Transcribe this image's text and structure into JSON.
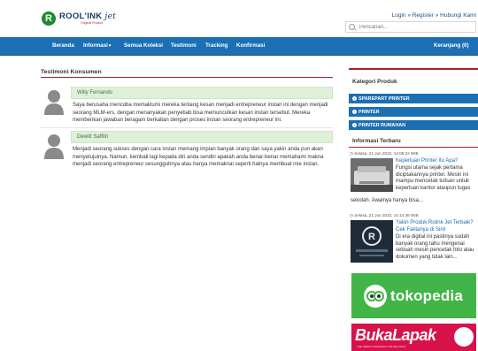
{
  "brand": {
    "logo_letter": "R",
    "name": "ROOL'INK",
    "name_suffix": "jet",
    "tagline": "Original Product"
  },
  "header": {
    "links": [
      "Login",
      "Register",
      "Hubungi Kami"
    ],
    "links_text": "Login » Register » Hubungi Kami",
    "search_placeholder": "Pencarian..."
  },
  "nav": {
    "items": [
      "Beranda",
      "Informasi",
      "Semua Koleksi",
      "Testimoni",
      "Tracking",
      "Konfirmasi"
    ],
    "informasi_caret": "▾",
    "cart": "Keranjang (0)"
  },
  "main": {
    "title": "Testimoni Konsumen",
    "testimonials": [
      {
        "name": "Willy Fernando",
        "text": "Saya berusaha mencoba memaklumi mereka tentang kesan menjadi entrepreneur instan ini dengan menjadi seorang MLM-ers, dengan menanyakan penyebab bisa memunculkan kesan instan tersebut. Mereka memberikan jawaban beragam berkaitan dengan proses instan seorang entrepreneur ini."
      },
      {
        "name": "Dewitt Saffitri",
        "text": "Menjadi seorang sukses dengan cara instan memang impian banyak orang dan saya yakin anda pun akan menyetujuinya. Namun, kembali lagi kepada diri anda sendiri apakah anda benar-benar memahami makna menjadi seorang entrepreneur sesungguhnya atau hanya memaknai seperti halnya membuat mie instan."
      }
    ]
  },
  "sidebar": {
    "kategori_title": "Kategori Produk",
    "categories": [
      "SPAREPART PRINTER",
      "PRINTER",
      "PRINTER RUMAHAN"
    ],
    "info_title": "Informasi Terbaru",
    "posts": [
      {
        "date": "Selasa, 21 Jun 2022, 14:09:22 WIB",
        "title": "Keperluan Printer Itu Apa?",
        "text_side": "Fungsi utama sejak pertama diciptakannya printer. Mesin ini mampu mencetak tulisan untuk keperluan kantor ataupun tugas",
        "text_below": "sekolah. Awalnya hanya bisa..."
      },
      {
        "date": "Selasa, 21 Jun 2022, 14:14:36 WIB",
        "title": "Yakin Produk Rolink Jet Terbaik? Cek Faktanya di Sini!",
        "text_side": "Di era digital ini pastinya sudah banyak orang tahu mengenai sebuah mesin pencetak foto atau dokumen yang tidak lain..."
      }
    ],
    "tokopedia": "tokopedia",
    "bukalapak": "BukaLapak",
    "bukalapak_sub": "THE GREAT INDONESIA ONLINE SHOP"
  },
  "colors": {
    "nav": "#1c6fb3",
    "accent_red": "#b21f2d",
    "green_panel": "#dff0d8",
    "tokopedia": "#42b549",
    "bukalapak": "#d71149"
  }
}
